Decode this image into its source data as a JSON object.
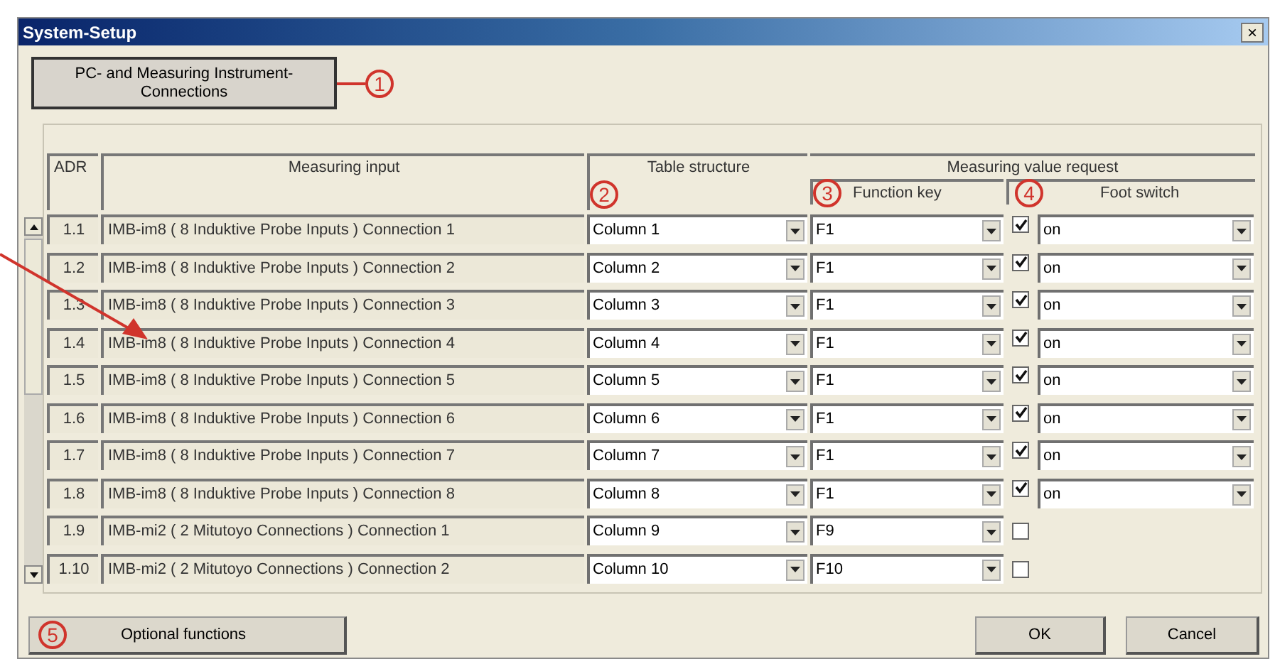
{
  "window": {
    "title": "System-Setup",
    "close": "×"
  },
  "connections_button": {
    "label": "PC- and Measuring Instrument-Connections",
    "marker": "1"
  },
  "table": {
    "columns": {
      "adr": "ADR",
      "input": "Measuring input",
      "structure": "Table structure",
      "structure_marker": "2",
      "request": "Measuring value request",
      "function_key": "Function key",
      "function_key_marker": "3",
      "foot_switch": "Foot switch",
      "foot_switch_marker": "4"
    },
    "rows": [
      {
        "adr": "1.1",
        "input": "IMB-im8 ( 8 Induktive Probe Inputs )  Connection 1",
        "structure": "Column 1",
        "function_key": "F1",
        "checked": true,
        "foot_switch": "on"
      },
      {
        "adr": "1.2",
        "input": "IMB-im8 ( 8 Induktive Probe Inputs )  Connection 2",
        "structure": "Column 2",
        "function_key": "F1",
        "checked": true,
        "foot_switch": "on"
      },
      {
        "adr": "1.3",
        "input": "IMB-im8 ( 8 Induktive Probe Inputs )  Connection 3",
        "structure": "Column 3",
        "function_key": "F1",
        "checked": true,
        "foot_switch": "on"
      },
      {
        "adr": "1.4",
        "input": "IMB-im8 ( 8 Induktive Probe Inputs )  Connection 4",
        "structure": "Column 4",
        "function_key": "F1",
        "checked": true,
        "foot_switch": "on"
      },
      {
        "adr": "1.5",
        "input": "IMB-im8 ( 8 Induktive Probe Inputs )  Connection 5",
        "structure": "Column 5",
        "function_key": "F1",
        "checked": true,
        "foot_switch": "on"
      },
      {
        "adr": "1.6",
        "input": "IMB-im8 ( 8 Induktive Probe Inputs )  Connection 6",
        "structure": "Column 6",
        "function_key": "F1",
        "checked": true,
        "foot_switch": "on"
      },
      {
        "adr": "1.7",
        "input": "IMB-im8 ( 8 Induktive Probe Inputs )  Connection 7",
        "structure": "Column 7",
        "function_key": "F1",
        "checked": true,
        "foot_switch": "on"
      },
      {
        "adr": "1.8",
        "input": "IMB-im8 ( 8 Induktive Probe Inputs )  Connection 8",
        "structure": "Column 8",
        "function_key": "F1",
        "checked": true,
        "foot_switch": "on"
      },
      {
        "adr": "1.9",
        "input": "IMB-mi2 ( 2 Mitutoyo Connections )  Connection 1",
        "structure": "Column 9",
        "function_key": "F9",
        "checked": false
      },
      {
        "adr": "1.10",
        "input": "IMB-mi2 ( 2 Mitutoyo Connections )  Connection 2",
        "structure": "Column 10",
        "function_key": "F10",
        "checked": false
      }
    ]
  },
  "buttons": [
    {
      "kind": "optional",
      "label": "Optional functions",
      "marker": "5"
    },
    {
      "kind": "ok",
      "label": "OK"
    },
    {
      "kind": "cancel",
      "label": "Cancel"
    }
  ]
}
